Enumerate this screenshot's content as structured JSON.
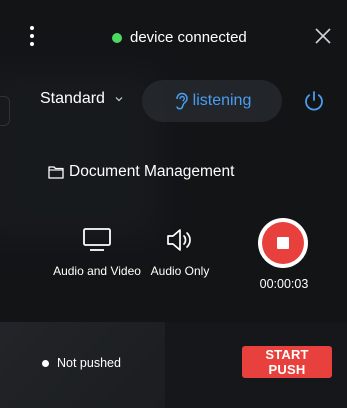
{
  "header": {
    "status_text": "device connected",
    "status_color": "#4cd964",
    "menu_icon": "more-vertical-icon",
    "close_icon": "close-icon"
  },
  "controls": {
    "quality_label": "Standard",
    "listening_label": "listening",
    "accent_color": "#4a9df0"
  },
  "folder": {
    "label": "Document Management",
    "icon": "folder-icon"
  },
  "actions": [
    {
      "label": "Audio and Video",
      "icon": "monitor-icon"
    },
    {
      "label": "Audio Only",
      "icon": "speaker-icon"
    }
  ],
  "record": {
    "color": "#e8403c",
    "elapsed": "00:00:03"
  },
  "push": {
    "status_text": "Not pushed",
    "button_label": "START PUSH",
    "button_color": "#e8403c"
  }
}
